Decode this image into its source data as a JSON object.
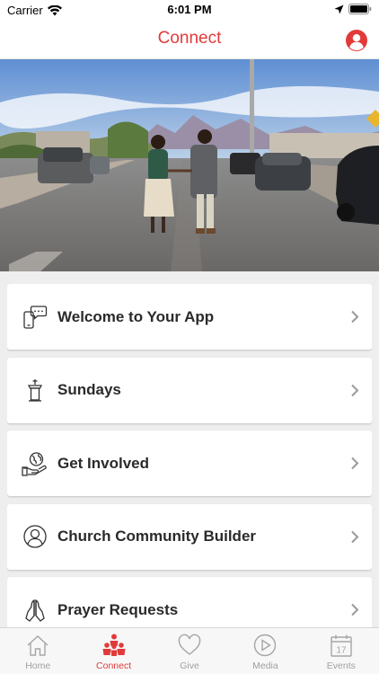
{
  "status_bar": {
    "carrier": "Carrier",
    "time": "6:01 PM"
  },
  "header": {
    "title": "Connect",
    "accent_color": "#e23a3a"
  },
  "hero": {
    "icon": "couple-walking-street-photo"
  },
  "menu": {
    "items": [
      {
        "label": "Welcome to Your App",
        "icon": "chat-phone-icon"
      },
      {
        "label": "Sundays",
        "icon": "pulpit-icon"
      },
      {
        "label": "Get Involved",
        "icon": "hand-globe-icon"
      },
      {
        "label": "Church Community Builder",
        "icon": "person-circle-icon"
      },
      {
        "label": "Prayer Requests",
        "icon": "praying-hands-icon"
      }
    ]
  },
  "tab_bar": {
    "tabs": [
      {
        "label": "Home",
        "icon": "home-icon",
        "active": false
      },
      {
        "label": "Connect",
        "icon": "people-icon",
        "active": true
      },
      {
        "label": "Give",
        "icon": "heart-icon",
        "active": false
      },
      {
        "label": "Media",
        "icon": "play-icon",
        "active": false
      },
      {
        "label": "Events",
        "icon": "calendar-icon",
        "active": false
      }
    ],
    "calendar_day": "17"
  }
}
